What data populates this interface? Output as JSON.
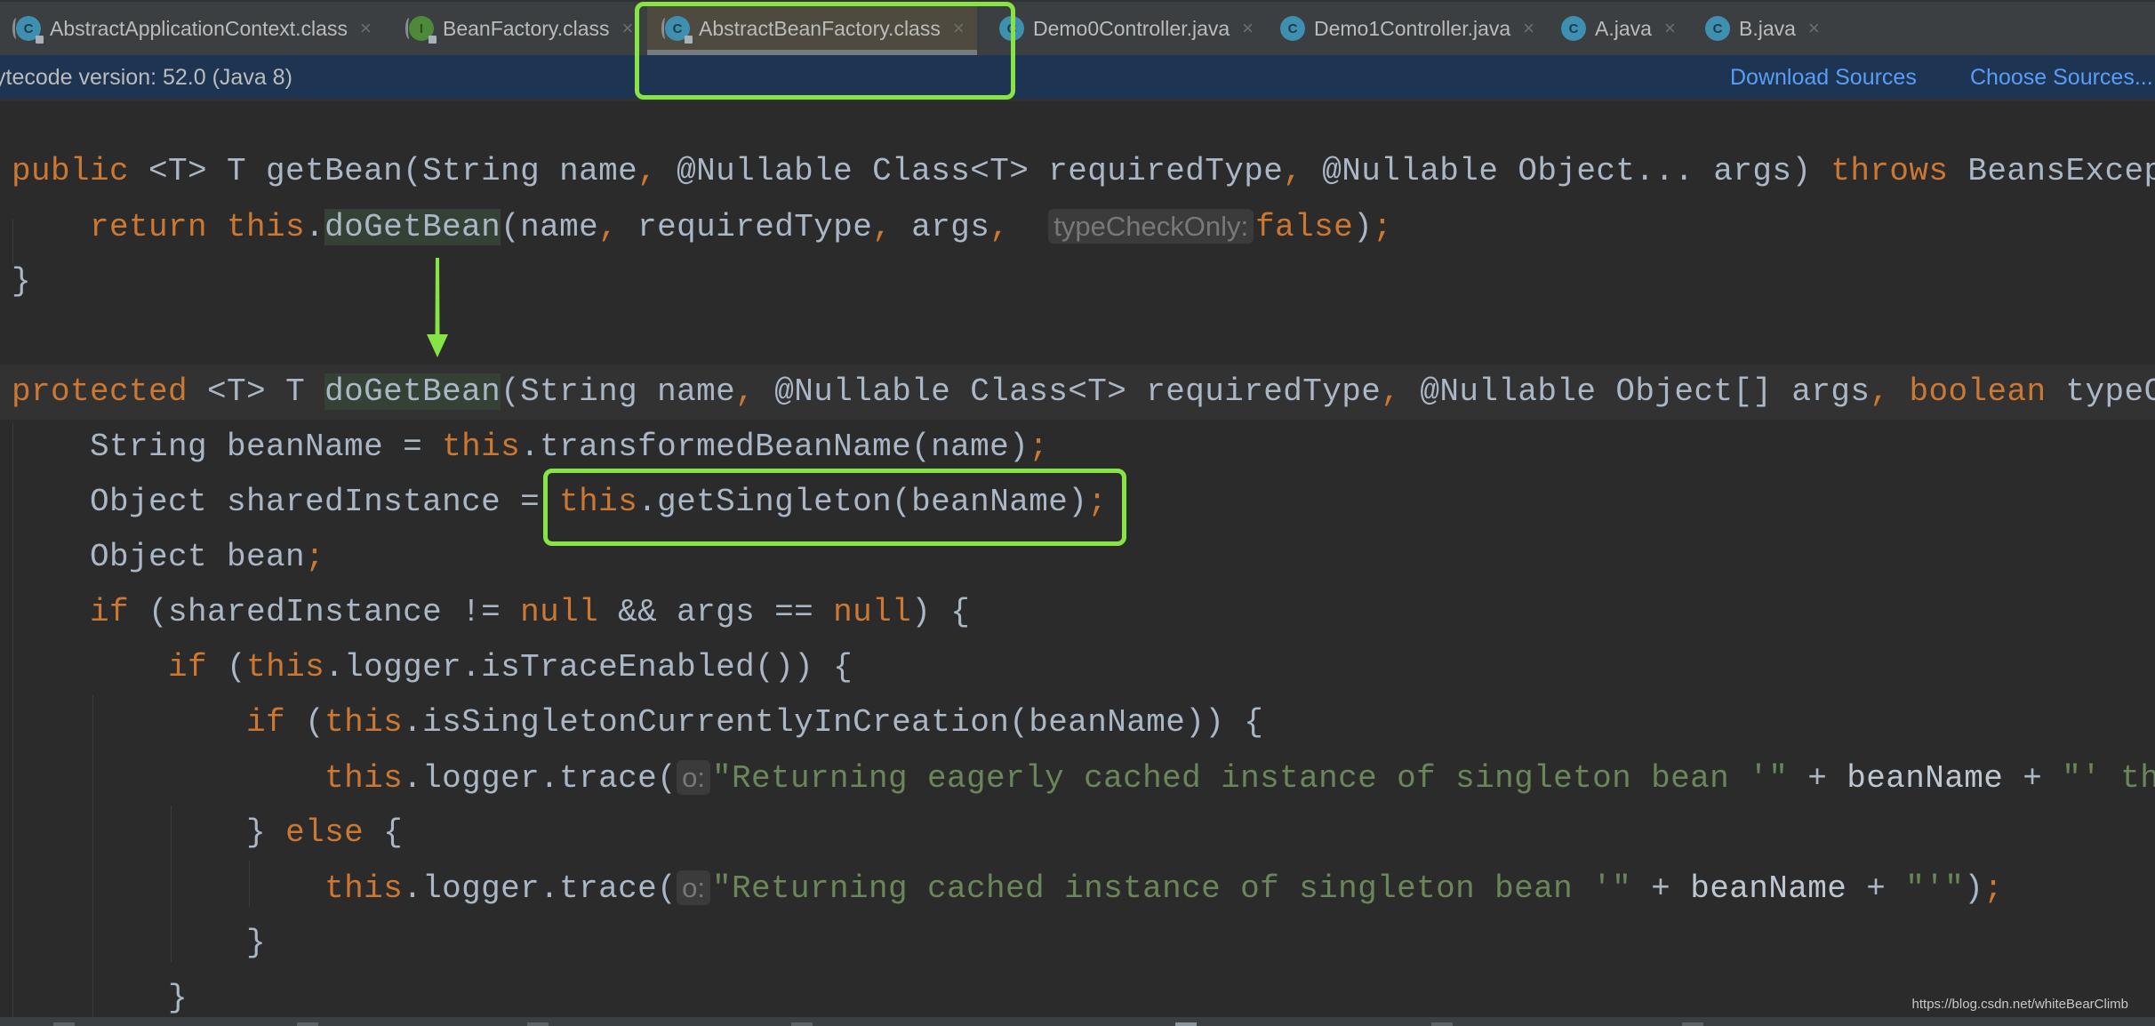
{
  "tabs": [
    {
      "label": "AbstractApplicationContext.class",
      "icon": "class-icon",
      "glyph": "C",
      "compiled": true,
      "active": false
    },
    {
      "label": "BeanFactory.class",
      "icon": "interface-icon",
      "glyph": "I",
      "compiled": true,
      "active": false
    },
    {
      "label": "AbstractBeanFactory.class",
      "icon": "class-icon",
      "glyph": "C",
      "compiled": true,
      "active": true
    },
    {
      "label": "Demo0Controller.java",
      "icon": "class-icon",
      "glyph": "C",
      "compiled": false,
      "active": false
    },
    {
      "label": "Demo1Controller.java",
      "icon": "class-icon",
      "glyph": "C",
      "compiled": false,
      "active": false
    },
    {
      "label": "A.java",
      "icon": "class-icon",
      "glyph": "C",
      "compiled": false,
      "active": false
    },
    {
      "label": "B.java",
      "icon": "class-icon",
      "glyph": "C",
      "compiled": false,
      "active": false
    }
  ],
  "tab_close_glyph": "×",
  "infobar": {
    "version_text": "ytecode version: 52.0 (Java 8)",
    "download_sources": "Download Sources",
    "choose_sources": "Choose Sources..."
  },
  "code": {
    "lines": [
      [
        {
          "t": "public",
          "c": "kw"
        },
        {
          "t": " <T> T getBean(String name"
        },
        {
          "t": ",",
          "c": "kw"
        },
        {
          "t": " @Nullable Class<T> requiredType"
        },
        {
          "t": ",",
          "c": "kw"
        },
        {
          "t": " @Nullable Object... args) "
        },
        {
          "t": "throws",
          "c": "kw"
        },
        {
          "t": " BeansException {"
        }
      ],
      [
        {
          "t": "    "
        },
        {
          "t": "return this",
          "c": "kw"
        },
        {
          "t": "."
        },
        {
          "t": "doGetBean",
          "c": "ident"
        },
        {
          "t": "(name"
        },
        {
          "t": ",",
          "c": "kw"
        },
        {
          "t": " requiredType"
        },
        {
          "t": ",",
          "c": "kw"
        },
        {
          "t": " args"
        },
        {
          "t": ",",
          "c": "kw"
        },
        {
          "t": "  "
        },
        {
          "t": "typeCheckOnly:",
          "c": "hint"
        },
        {
          "t": "false",
          "c": "kw"
        },
        {
          "t": ")"
        },
        {
          "t": ";",
          "c": "kw"
        }
      ],
      [
        {
          "t": "}"
        }
      ],
      [
        {
          "t": ""
        }
      ],
      [
        {
          "t": "protected",
          "c": "kw"
        },
        {
          "t": " <T> T "
        },
        {
          "t": "doGetBean",
          "c": "ident"
        },
        {
          "t": "(String name"
        },
        {
          "t": ",",
          "c": "kw"
        },
        {
          "t": " @Nullable Class<T> requiredType"
        },
        {
          "t": ",",
          "c": "kw"
        },
        {
          "t": " @Nullable Object[] args"
        },
        {
          "t": ",",
          "c": "kw"
        },
        {
          "t": " "
        },
        {
          "t": "boolean",
          "c": "kw"
        },
        {
          "t": " typeCheckOnly) throws BeansException {"
        }
      ],
      [
        {
          "t": "    String beanName = "
        },
        {
          "t": "this",
          "c": "kw"
        },
        {
          "t": ".transformedBeanName(name)"
        },
        {
          "t": ";",
          "c": "kw"
        }
      ],
      [
        {
          "t": "    Object sharedInstance = "
        },
        {
          "t": "this",
          "c": "kw"
        },
        {
          "t": ".getSingleton(beanName)"
        },
        {
          "t": ";",
          "c": "kw"
        }
      ],
      [
        {
          "t": "    Object bean"
        },
        {
          "t": ";",
          "c": "kw"
        }
      ],
      [
        {
          "t": "    "
        },
        {
          "t": "if",
          "c": "kw"
        },
        {
          "t": " (sharedInstance != "
        },
        {
          "t": "null",
          "c": "kw"
        },
        {
          "t": " && args == "
        },
        {
          "t": "null",
          "c": "kw"
        },
        {
          "t": ") {"
        }
      ],
      [
        {
          "t": "        "
        },
        {
          "t": "if",
          "c": "kw"
        },
        {
          "t": " ("
        },
        {
          "t": "this",
          "c": "kw"
        },
        {
          "t": ".logger.isTraceEnabled()) {"
        }
      ],
      [
        {
          "t": "            "
        },
        {
          "t": "if",
          "c": "kw"
        },
        {
          "t": " ("
        },
        {
          "t": "this",
          "c": "kw"
        },
        {
          "t": ".isSingletonCurrentlyInCreation(beanName)) {"
        }
      ],
      [
        {
          "t": "                "
        },
        {
          "t": "this",
          "c": "kw"
        },
        {
          "t": ".logger.trace("
        },
        {
          "t": "o:",
          "c": "hint"
        },
        {
          "t": "\"Returning eagerly cached instance of singleton bean '\"",
          "c": "str"
        },
        {
          "t": " + "
        },
        {
          "t": "beanName",
          "c": "var"
        },
        {
          "t": " + "
        },
        {
          "t": "\"' that is not fully initialized yet\"",
          "c": "str"
        }
      ],
      [
        {
          "t": "            } "
        },
        {
          "t": "else",
          "c": "kw"
        },
        {
          "t": " {"
        }
      ],
      [
        {
          "t": "                "
        },
        {
          "t": "this",
          "c": "kw"
        },
        {
          "t": ".logger.trace("
        },
        {
          "t": "o:",
          "c": "hint"
        },
        {
          "t": "\"Returning cached instance of singleton bean '\"",
          "c": "str"
        },
        {
          "t": " + "
        },
        {
          "t": "beanName",
          "c": "var"
        },
        {
          "t": " + "
        },
        {
          "t": "\"'\"",
          "c": "str"
        },
        {
          "t": ")"
        },
        {
          "t": ";",
          "c": "kw"
        }
      ],
      [
        {
          "t": "            }"
        }
      ],
      [
        {
          "t": "        }"
        }
      ]
    ],
    "highlighted_line": 4
  },
  "annotations": {
    "active_tab_box": "highlight AbstractBeanFactory.class tab",
    "call_box": "highlight this.getSingleton(beanName);",
    "arrow": "doGetBean call -> doGetBean declaration"
  },
  "watermark": "https://blog.csdn.net/whiteBearClimb"
}
